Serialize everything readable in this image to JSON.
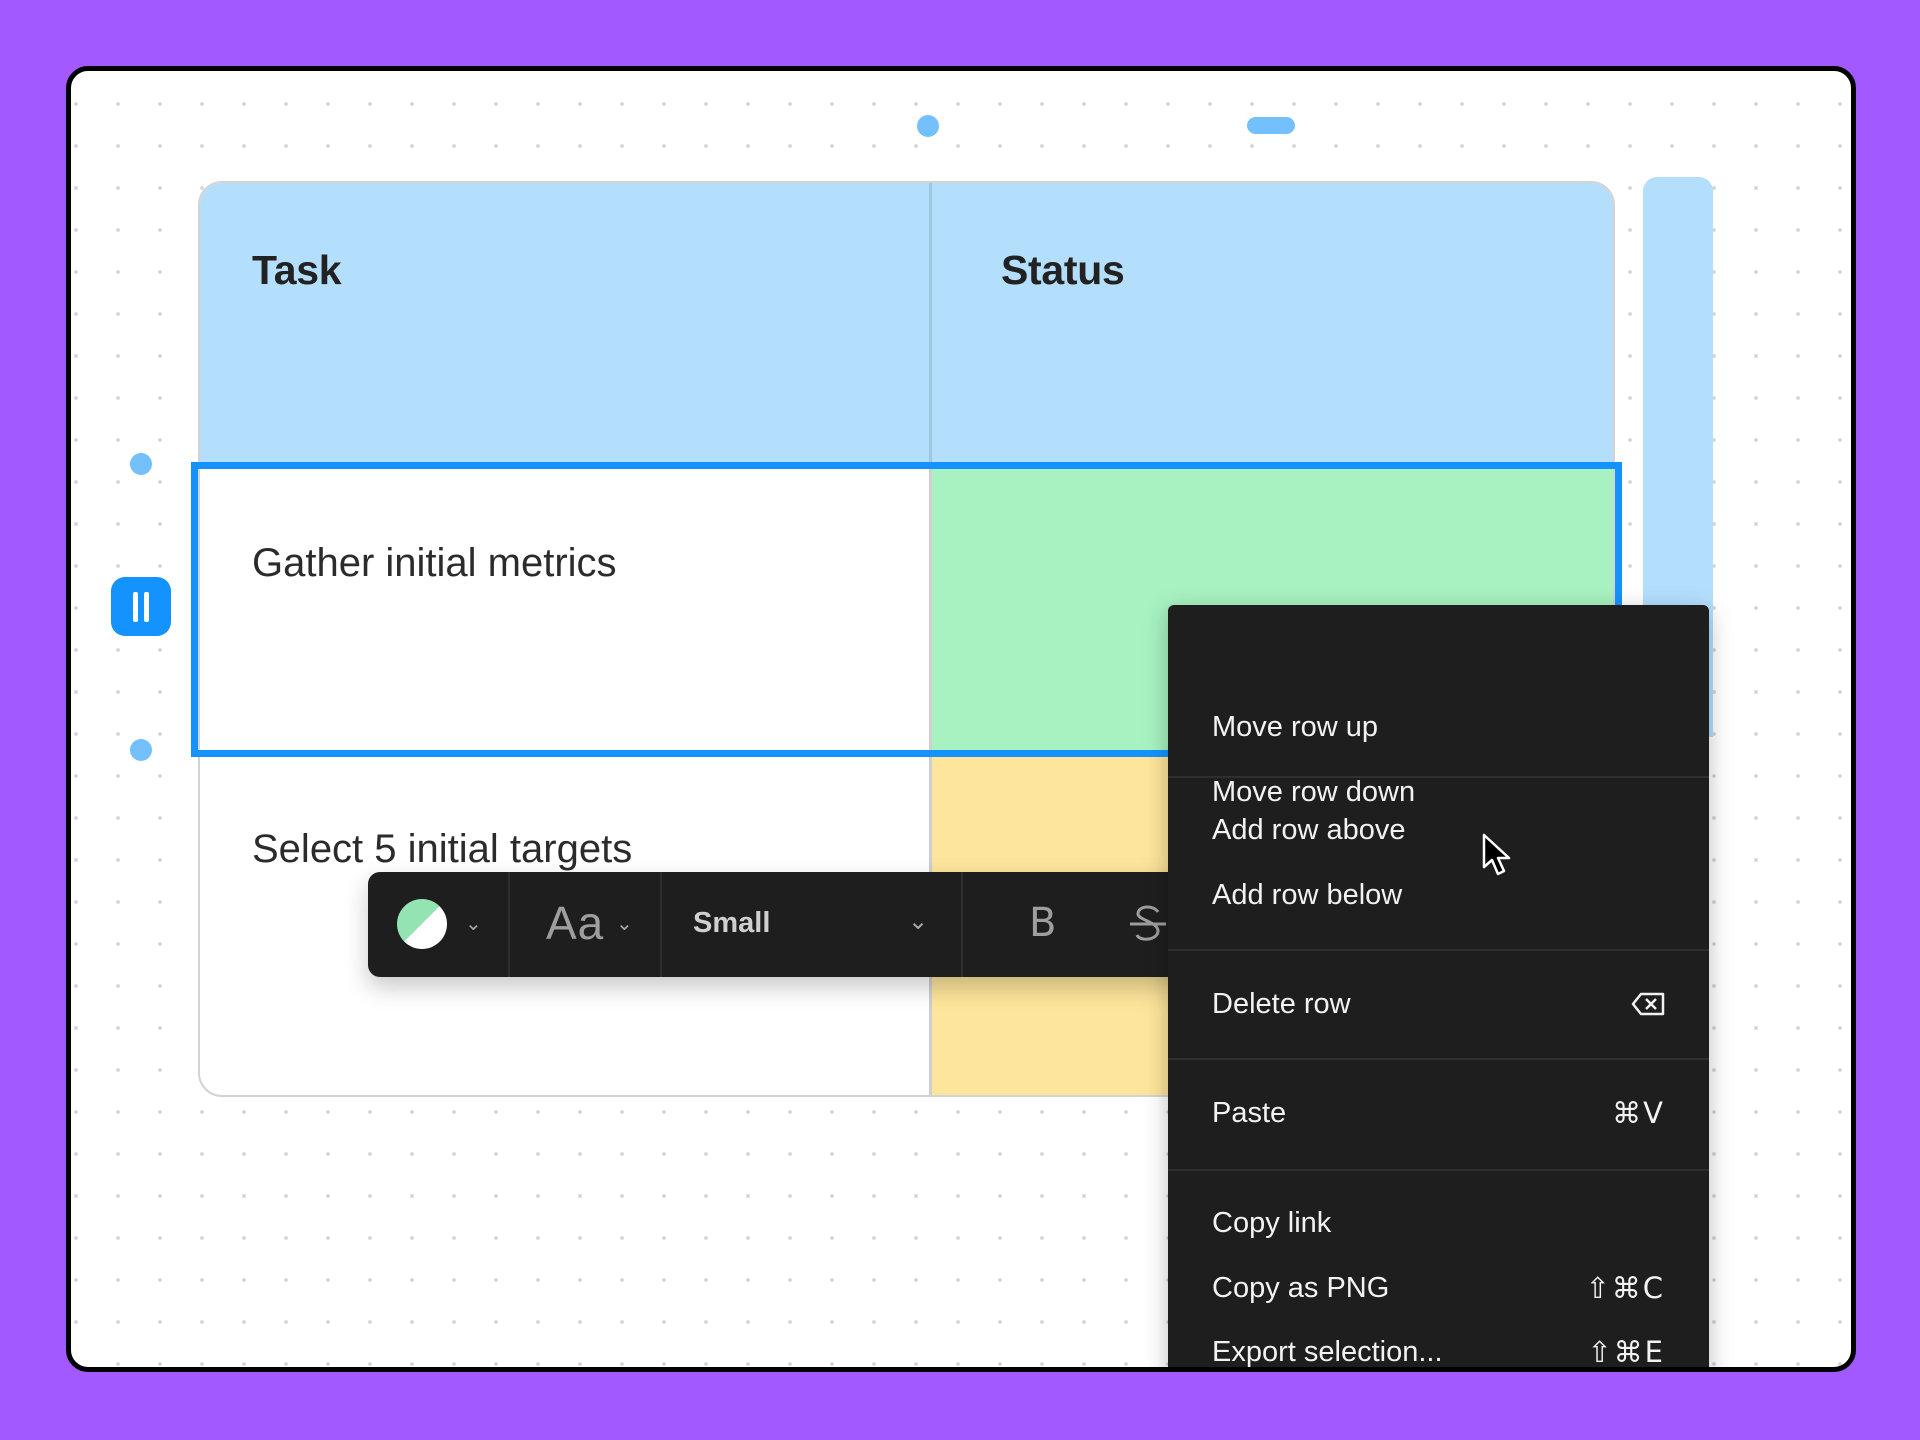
{
  "table": {
    "headers": [
      "Task",
      "Status"
    ],
    "rows": [
      {
        "task": "Gather initial metrics",
        "status": "",
        "status_color": "#a7f2c0",
        "selected": true
      },
      {
        "task": "Select 5 initial targets",
        "status": "",
        "status_color": "#fde59b",
        "selected": false
      }
    ],
    "header_color": "#b3dffd",
    "selection_color": "#1493ff"
  },
  "toolbar": {
    "color_picker": {
      "icon": "color-swatch-icon",
      "fill_color": "#94e3b2"
    },
    "font_style_label": "Aa",
    "text_size": {
      "selected": "Small"
    },
    "bold_label": "B",
    "strikethrough_label": "S"
  },
  "context_menu": {
    "groups": [
      [
        {
          "label": "Move row up",
          "shortcut": ""
        },
        {
          "label": "Move row down",
          "shortcut": ""
        }
      ],
      [
        {
          "label": "Add row above",
          "shortcut": ""
        },
        {
          "label": "Add row below",
          "shortcut": ""
        }
      ],
      [
        {
          "label": "Delete row",
          "shortcut": "⌫",
          "shortcut_icon": "backspace-icon"
        }
      ],
      [
        {
          "label": "Paste",
          "shortcut": "⌘V"
        }
      ],
      [
        {
          "label": "Copy link",
          "shortcut": ""
        },
        {
          "label": "Copy as PNG",
          "shortcut": "⇧⌘C"
        },
        {
          "label": "Export selection...",
          "shortcut": "⇧⌘E"
        }
      ]
    ]
  },
  "colors": {
    "background": "#a259ff",
    "menu_background": "#1e1e1e",
    "handle_accent": "#74c0fc"
  }
}
